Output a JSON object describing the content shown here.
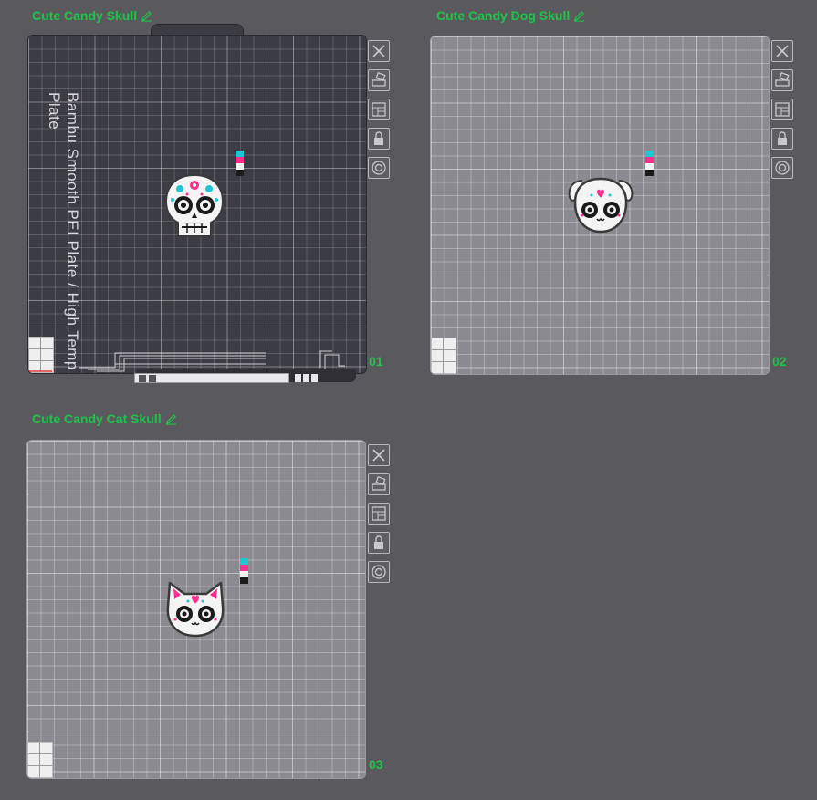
{
  "plates": [
    {
      "title": "Cute Candy Skull",
      "number": "01",
      "plate_name": "Bambu Smooth PEI Plate / High Temp Plate",
      "model_name": "skull",
      "theme": "dark"
    },
    {
      "title": "Cute Candy Dog Skull",
      "number": "02",
      "model_name": "dog-skull",
      "theme": "light"
    },
    {
      "title": "Cute Candy Cat Skull",
      "number": "03",
      "model_name": "cat-skull",
      "theme": "light"
    }
  ],
  "toolbar_icons": [
    "close-icon",
    "auto-orient-icon",
    "arrange-icon",
    "lock-icon",
    "settings-icon"
  ],
  "wipe_tower_colors": [
    "#1ec6d4",
    "#ff2d8f",
    "#f2f2f2",
    "#1c1c1c"
  ],
  "colors": {
    "title_green": "#1fc34a",
    "background": "#5a5a5e",
    "dark_plate": "#3c3c44",
    "light_plate": "#8a8a90",
    "accent_pink": "#ff2d8f",
    "accent_cyan": "#1ec6d4"
  }
}
